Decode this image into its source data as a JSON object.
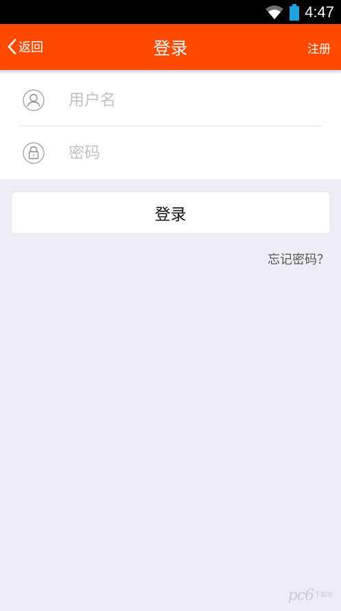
{
  "status_bar": {
    "time": "4:47",
    "icons": [
      "wifi-icon",
      "battery-icon"
    ]
  },
  "navbar": {
    "back_label": "返回",
    "title": "登录",
    "register_label": "注册",
    "background_color": "#ff4a00"
  },
  "form": {
    "username": {
      "icon": "user-icon",
      "placeholder": "用户名",
      "value": ""
    },
    "password": {
      "icon": "lock-icon",
      "placeholder": "密码",
      "value": ""
    }
  },
  "login_button": {
    "label": "登录"
  },
  "forgot_password": {
    "label": "忘记密码？"
  },
  "watermark": {
    "text": "pc6",
    "sub": "下载站"
  }
}
